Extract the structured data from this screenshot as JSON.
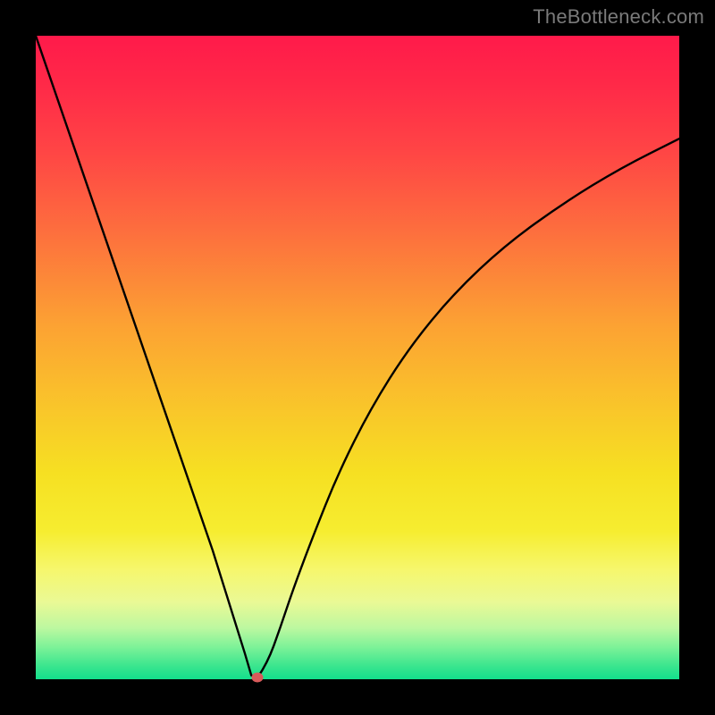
{
  "watermark": "TheBottleneck.com",
  "chart_data": {
    "type": "line",
    "title": "",
    "xlabel": "",
    "ylabel": "",
    "xlim": [
      0,
      100
    ],
    "ylim": [
      0,
      100
    ],
    "grid": false,
    "legend": false,
    "series": [
      {
        "name": "left-branch",
        "x": [
          0,
          5.5,
          11,
          16.5,
          22,
          27.5,
          32.5,
          33.5,
          34.5
        ],
        "y": [
          100,
          84,
          68,
          52,
          36,
          20,
          4,
          0.6,
          0.3
        ]
      },
      {
        "name": "right-branch",
        "x": [
          34.5,
          36,
          38,
          40,
          43,
          47,
          52,
          58,
          65,
          73,
          82,
          91,
          100
        ],
        "y": [
          0.3,
          2.5,
          8,
          14,
          22,
          32,
          42,
          51.5,
          60,
          67.5,
          74,
          79.5,
          84
        ]
      }
    ],
    "marker": {
      "x": 34.5,
      "y": 0.3,
      "color": "#d85a5a"
    }
  }
}
